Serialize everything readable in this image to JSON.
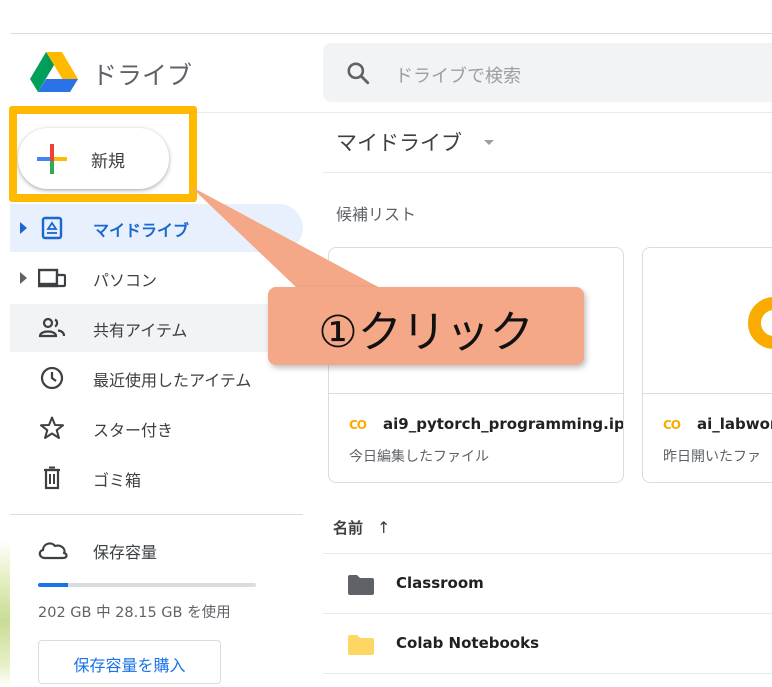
{
  "app": {
    "title": "ドライブ",
    "search_placeholder": "ドライブで検索"
  },
  "new_button": {
    "label": "新規"
  },
  "sidebar": {
    "items": [
      {
        "label": "マイドライブ",
        "icon": "my-drive-icon",
        "expandable": true,
        "active": true
      },
      {
        "label": "パソコン",
        "icon": "computers-icon",
        "expandable": true
      },
      {
        "label": "共有アイテム",
        "icon": "shared-people-icon"
      },
      {
        "label": "最近使用したアイテム",
        "icon": "clock-icon"
      },
      {
        "label": "スター付き",
        "icon": "star-icon"
      },
      {
        "label": "ゴミ箱",
        "icon": "trash-icon"
      }
    ],
    "storage": {
      "title": "保存容量",
      "usage_text": "202 GB 中 28.15 GB を使用",
      "used_fraction": 0.139,
      "buy_label": "保存容量を購入"
    }
  },
  "main": {
    "folder_title": "マイドライブ",
    "suggested_label": "候補リスト",
    "cards": [
      {
        "icon": "colab-icon",
        "icon_text": "CO",
        "name": "ai9_pytorch_programming.ip...",
        "subtitle": "今日編集したファイル"
      },
      {
        "icon": "colab-icon",
        "icon_text": "CO",
        "name": "ai_labwork",
        "subtitle": "昨日開いたファ"
      }
    ],
    "list_header": {
      "name_label": "名前",
      "sort_arrow": "↑"
    },
    "files": [
      {
        "name": "Classroom",
        "icon": "folder-icon",
        "color": "#5f6368"
      },
      {
        "name": "Colab Notebooks",
        "icon": "folder-icon",
        "color": "#fdd663"
      }
    ]
  },
  "annotation": {
    "callout_text": "①クリック",
    "highlight_color": "#ffb900",
    "callout_color": "#f4a887"
  },
  "colors": {
    "accent_blue": "#1a73e8",
    "active_bg": "#e8f0fe",
    "colab_orange": "#f9ab00"
  }
}
